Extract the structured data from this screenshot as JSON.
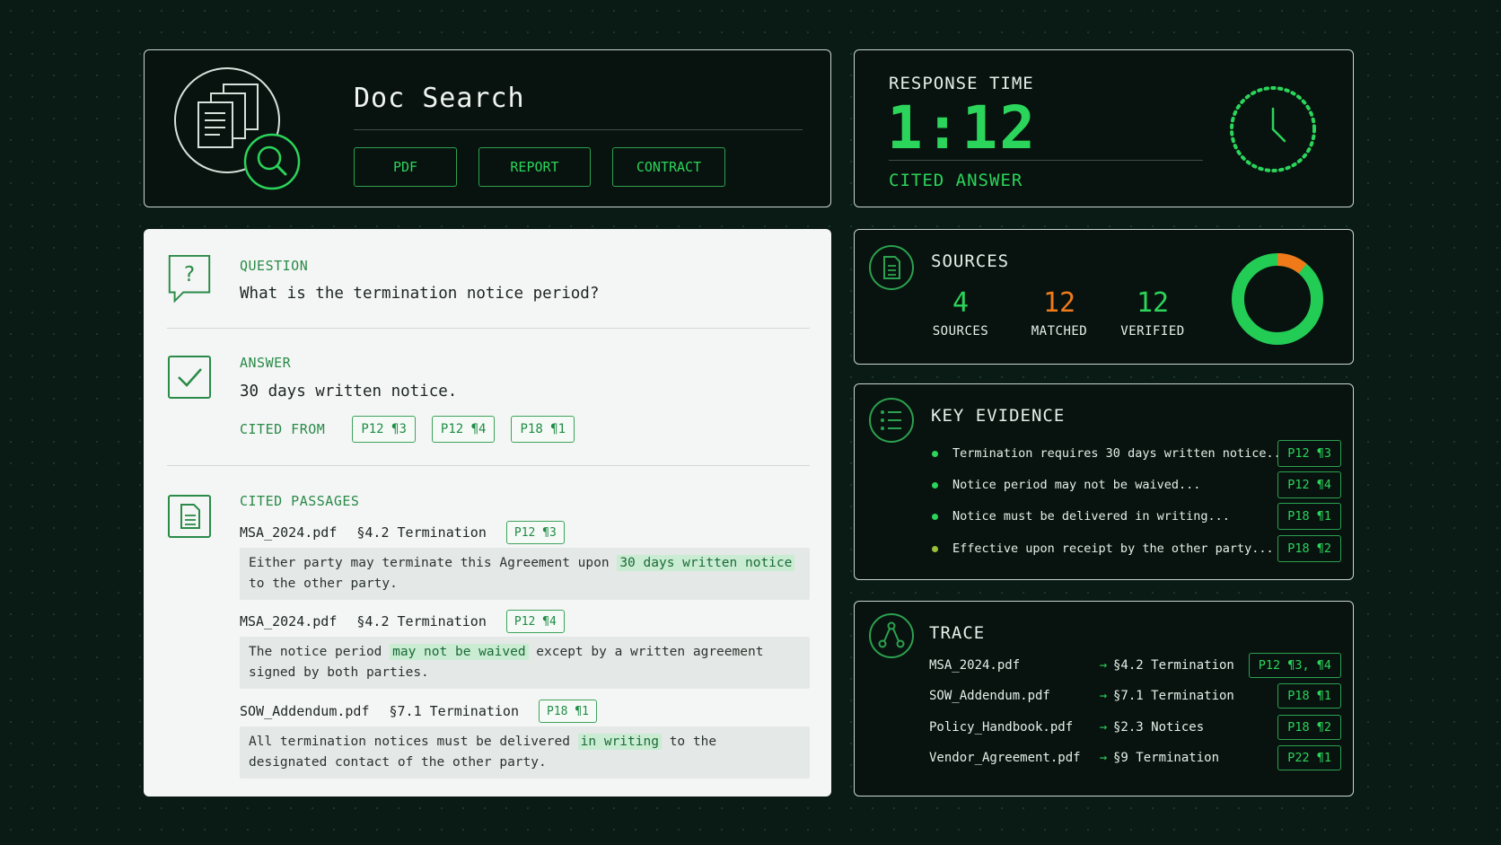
{
  "app": {
    "title": "Doc Search",
    "filters": [
      "PDF",
      "REPORT",
      "CONTRACT"
    ]
  },
  "response": {
    "label": "RESPONSE TIME",
    "time": "1:12",
    "subtitle": "CITED ANSWER"
  },
  "qa": {
    "question_label": "QUESTION",
    "question": "What is the termination notice period?",
    "answer_label": "ANSWER",
    "answer": "30 days written notice.",
    "cited_from_label": "CITED FROM",
    "citations": [
      "P12 ¶3",
      "P12 ¶4",
      "P18 ¶1"
    ]
  },
  "passages": {
    "label": "CITED PASSAGES",
    "items": [
      {
        "file": "MSA_2024.pdf",
        "section": "§4.2 Termination",
        "cite": "P12 ¶3",
        "pre": "Either party may terminate this Agreement upon ",
        "highlight": "30 days written notice",
        "post": " to the other party."
      },
      {
        "file": "MSA_2024.pdf",
        "section": "§4.2 Termination",
        "cite": "P12 ¶4",
        "pre": "The notice period ",
        "highlight": "may not be waived",
        "post": " except by a written agreement signed by both parties."
      },
      {
        "file": "SOW_Addendum.pdf",
        "section": "§7.1 Termination",
        "cite": "P18 ¶1",
        "pre": "All termination notices must be delivered ",
        "highlight": "in writing",
        "post": " to the designated contact of the other party."
      }
    ]
  },
  "sources": {
    "title": "SOURCES",
    "stats": [
      {
        "value": "4",
        "label": "SOURCES",
        "color": "#2bd45a"
      },
      {
        "value": "12",
        "label": "MATCHED",
        "color": "#f07a1a"
      },
      {
        "value": "12",
        "label": "VERIFIED",
        "color": "#2bd45a"
      }
    ],
    "donut": {
      "orange_fraction": 0.11,
      "green_color": "#22cc55",
      "orange_color": "#f07a1a"
    }
  },
  "evidence": {
    "title": "KEY EVIDENCE",
    "items": [
      {
        "text": "Termination requires 30 days written notice...",
        "cite": "P12 ¶3"
      },
      {
        "text": "Notice period may not be waived...",
        "cite": "P12 ¶4"
      },
      {
        "text": "Notice must be delivered in writing...",
        "cite": "P18 ¶1"
      },
      {
        "text": "Effective upon receipt by the other party...",
        "cite": "P18 ¶2"
      }
    ]
  },
  "trace": {
    "title": "TRACE",
    "items": [
      {
        "file": "MSA_2024.pdf",
        "section": "§4.2 Termination",
        "cite": "P12 ¶3, ¶4"
      },
      {
        "file": "SOW_Addendum.pdf",
        "section": "§7.1 Termination",
        "cite": "P18 ¶1"
      },
      {
        "file": "Policy_Handbook.pdf",
        "section": "§2.3 Notices",
        "cite": "P18 ¶2"
      },
      {
        "file": "Vendor_Agreement.pdf",
        "section": "§9 Termination",
        "cite": "P22 ¶1"
      }
    ]
  },
  "icons": {
    "logo": "documents-search-icon",
    "clock": "clock-icon",
    "question": "question-bubble-icon",
    "answer": "checkmark-icon",
    "passages": "document-icon",
    "sources": "document-circle-icon",
    "evidence": "list-icon",
    "trace": "network-icon"
  },
  "colors": {
    "accent": "#2bd45a",
    "orange": "#f07a1a",
    "background": "#0a1a15"
  }
}
